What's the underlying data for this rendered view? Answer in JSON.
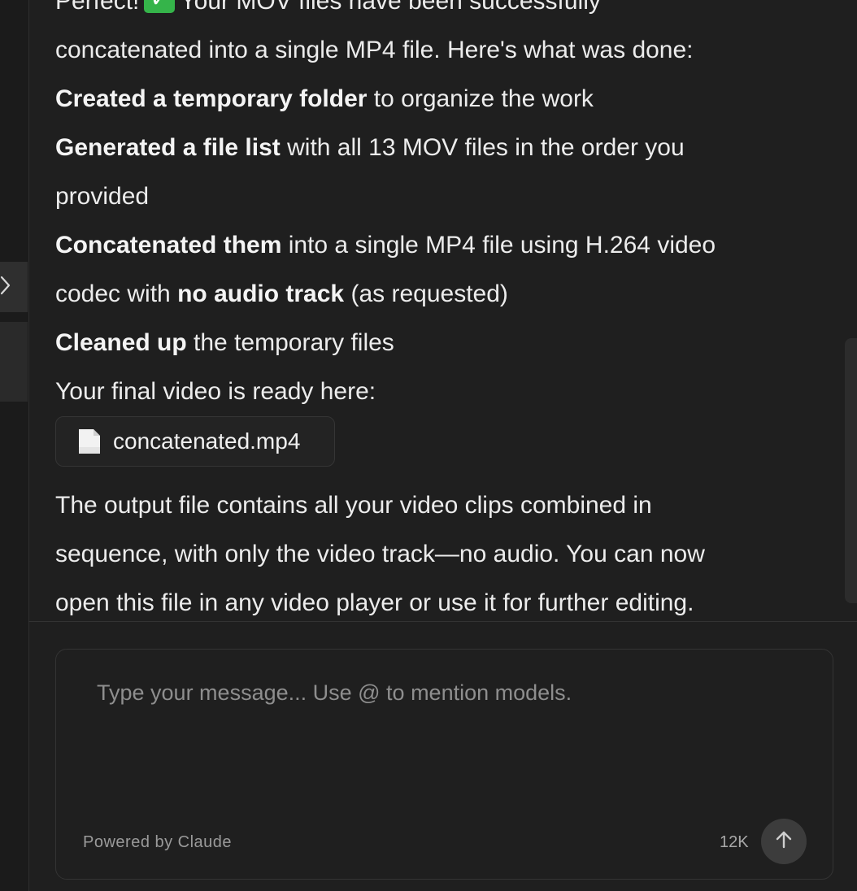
{
  "message": {
    "line0_prefix": "Perfect!",
    "line0_suffix": "Your MOV files have been successfully",
    "line1": "concatenated into a single MP4 file. Here's what was done:",
    "step1_bold": "Created a temporary folder",
    "step1_rest": " to organize the work",
    "step2_bold": "Generated a file list",
    "step2_rest": " with all 13 MOV files in the order you",
    "step2_cont": "provided",
    "step3_bold": "Concatenated them",
    "step3_rest": " into a single MP4 file using H.264 video",
    "step3_cont_pre": "codec with ",
    "step3_cont_bold": "no audio track",
    "step3_cont_post": " (as requested)",
    "step4_bold": "Cleaned up",
    "step4_rest": " the temporary files",
    "ready": "Your final video is ready here:",
    "outro1": "The output file contains all your video clips combined in",
    "outro2": "sequence, with only the video track—no audio. You can now",
    "outro3": "open this file in any video player or use it for further editing."
  },
  "attachment": {
    "file_name": "concatenated.mp4",
    "icon": "mp4-file-icon",
    "icon_badge": "mp4"
  },
  "composer": {
    "placeholder": "Type your message... Use @ to mention models.",
    "value": "",
    "powered_by": "Powered by Claude",
    "token_count": "12K",
    "send_icon": "arrow-up-icon"
  },
  "sidebar": {
    "toggle_icon": "chevron-right-icon"
  },
  "colors": {
    "background": "#1f1f1f",
    "check_badge": "#35b44a",
    "text": "#ececec"
  }
}
